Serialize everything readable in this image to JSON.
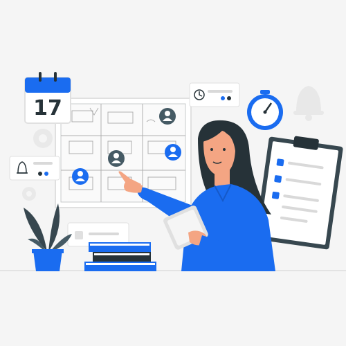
{
  "calendar": {
    "day": "17",
    "icon": "calendar-icon"
  },
  "colors": {
    "accent": "#1a6cf0",
    "dark": "#263238",
    "skin": "#f4a583",
    "hair": "#263238",
    "paper": "#ffffff",
    "line": "#d9d9d9",
    "background": "#f5f5f5"
  },
  "icons": [
    "clock-icon",
    "stopwatch-icon",
    "bell-icon",
    "gear-icon",
    "user-icon",
    "checkbox-icon",
    "clipboard-icon",
    "tablet-icon",
    "plant-icon",
    "books-icon"
  ],
  "checklist": {
    "items_checked": 3
  },
  "floor_plan": {
    "user_pins": 4
  }
}
